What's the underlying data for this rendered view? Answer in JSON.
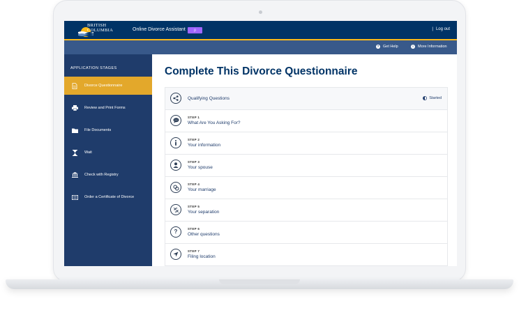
{
  "header": {
    "logo_lines": [
      "BRITISH",
      "COLUMBIA"
    ],
    "app_title": "Online Divorce Assistant",
    "beta_badge": "β",
    "logout": "Log out"
  },
  "subheader": {
    "get_help": "Get Help",
    "more_information": "More Information"
  },
  "sidebar": {
    "heading": "APPLICATION STAGES",
    "items": [
      {
        "label": "Divorce Questionnaire",
        "icon": "document-icon",
        "active": true
      },
      {
        "label": "Review and Print Forms",
        "icon": "printer-icon",
        "active": false
      },
      {
        "label": "File Documents",
        "icon": "folder-icon",
        "active": false
      },
      {
        "label": "Wait",
        "icon": "hourglass-icon",
        "active": false
      },
      {
        "label": "Check with Registry",
        "icon": "building-icon",
        "active": false
      },
      {
        "label": "Order a Certificate of Divorce",
        "icon": "certificate-icon",
        "active": false
      }
    ]
  },
  "main": {
    "title": "Complete This Divorce Questionnaire",
    "qualifying": {
      "label": "Qualifying Questions",
      "status": "Started",
      "icon": "share-icon"
    },
    "steps": [
      {
        "step": "STEP 1",
        "label": "What Are You Asking For?",
        "icon": "chat-icon"
      },
      {
        "step": "STEP 2",
        "label": "Your information",
        "icon": "info-icon"
      },
      {
        "step": "STEP 3",
        "label": "Your spouse",
        "icon": "person-icon"
      },
      {
        "step": "STEP 4",
        "label": "Your marriage",
        "icon": "rings-icon"
      },
      {
        "step": "STEP 5",
        "label": "Your separation",
        "icon": "broken-link-icon"
      },
      {
        "step": "STEP 6",
        "label": "Other questions",
        "icon": "question-icon"
      },
      {
        "step": "STEP 7",
        "label": "Filing location",
        "icon": "location-arrow-icon"
      }
    ]
  }
}
